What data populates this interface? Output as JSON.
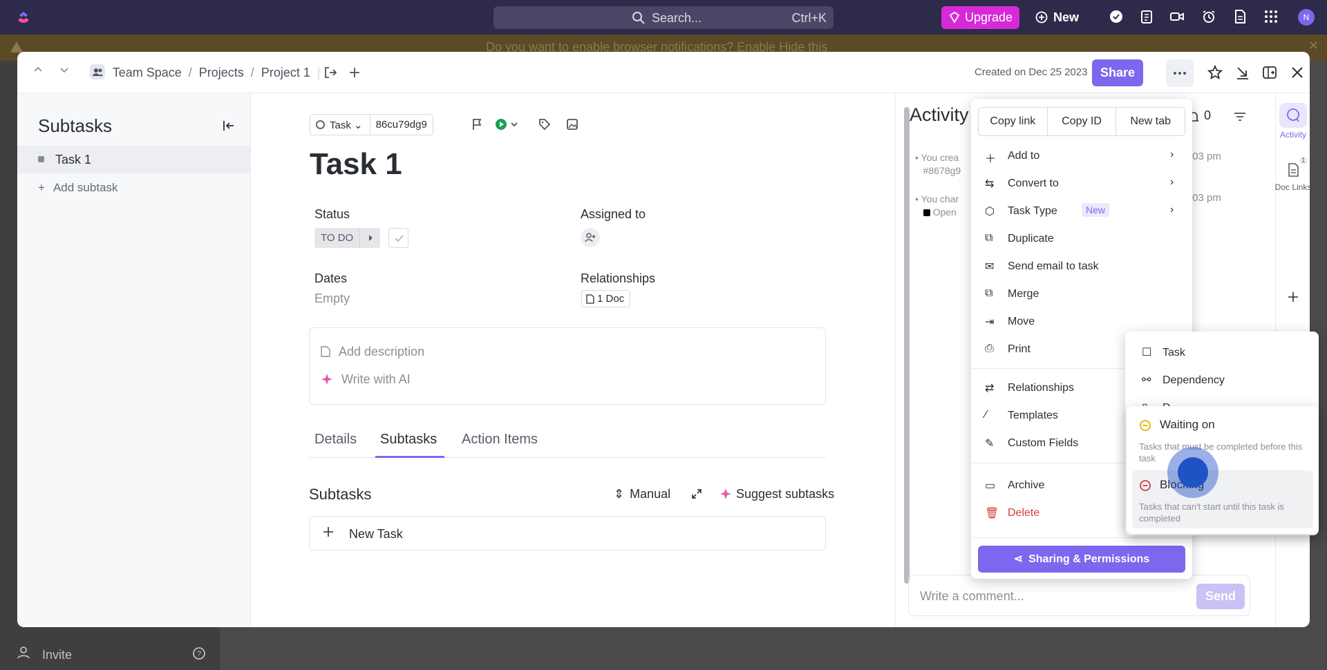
{
  "topbar": {
    "search_label": "Search...",
    "search_shortcut": "Ctrl+K",
    "upgrade_label": "Upgrade",
    "new_label": "New",
    "avatar_initial": "N",
    "accent": "#7b68ee",
    "upgrade_color": "#d62ad8"
  },
  "notification": {
    "message": "Do you want to enable browser notifications?   Enable   Hide this"
  },
  "sidebar_bg": {
    "invite_label": "Invite"
  },
  "modal": {
    "breadcrumb": [
      "Team Space",
      "Projects",
      "Project 1"
    ],
    "created": "Created on Dec 25 2023",
    "share_label": "Share"
  },
  "subtasks_panel": {
    "title": "Subtasks",
    "items": [
      {
        "label": "Task 1"
      }
    ],
    "add_label": "Add subtask"
  },
  "task": {
    "type_label": "Task",
    "task_id": "86cu79dg9",
    "title": "Task 1",
    "status_label": "Status",
    "status_value": "TO DO",
    "assigned_label": "Assigned to",
    "dates_label": "Dates",
    "dates_value": "Empty",
    "relationships_label": "Relationships",
    "relationships_value": "1 Doc",
    "add_description": "Add description",
    "write_ai": "Write with AI",
    "tabs": [
      "Details",
      "Subtasks",
      "Action Items"
    ],
    "active_tab": "Subtasks",
    "subtasks_heading": "Subtasks",
    "manual_label": "Manual",
    "suggest_label": "Suggest subtasks",
    "new_task_label": "New Task"
  },
  "activity": {
    "title": "Activity",
    "bell_count": "0",
    "entries": [
      {
        "line1": "You  crea",
        "line2": "#8678g9",
        "time": ":03 pm"
      },
      {
        "line1": "You  char",
        "line2": "Open",
        "time": ":03 pm"
      }
    ],
    "comment_placeholder": "Write a comment...",
    "send_label": "Send"
  },
  "rail": {
    "activity_label": "Activity",
    "doclinks_label": "Doc Links",
    "doclinks_badge": "1"
  },
  "menu": {
    "copy_buttons": [
      "Copy link",
      "Copy ID",
      "New tab"
    ],
    "items": [
      {
        "label": "Add to"
      },
      {
        "label": "Convert to"
      },
      {
        "label": "Task Type",
        "tag": "New"
      },
      {
        "label": "Duplicate"
      },
      {
        "label": "Send email to task"
      },
      {
        "label": "Merge"
      },
      {
        "label": "Move"
      },
      {
        "label": "Print"
      },
      {
        "label": "Relationships"
      },
      {
        "label": "Templates"
      },
      {
        "label": "Custom Fields"
      },
      {
        "label": "Archive"
      },
      {
        "label": "Delete"
      }
    ],
    "sharing_label": "Sharing & Permissions"
  },
  "relationship_submenu": {
    "items": [
      {
        "label": "Task"
      },
      {
        "label": "Dependency"
      },
      {
        "label": "D"
      }
    ]
  },
  "dependency_menu": {
    "items": [
      {
        "title": "Waiting on",
        "desc": "Tasks that must be completed before this task"
      },
      {
        "title": "Blocking",
        "desc": "Tasks that can't start until this task is completed"
      }
    ]
  }
}
